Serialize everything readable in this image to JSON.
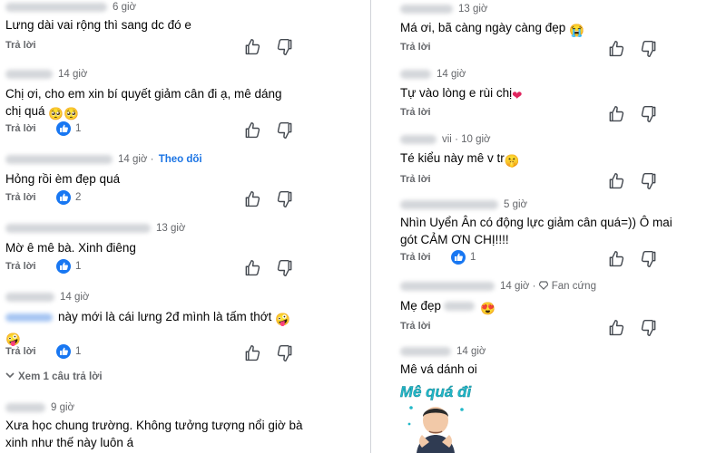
{
  "left": [
    {
      "time": "6 giờ",
      "text": [
        "Lưng dài vai rộng thì sang dc đó e"
      ],
      "reply": "Trả lời",
      "likes": ""
    },
    {
      "time": "14 giờ",
      "text": [
        "Chị ơi, cho em xin bí quyết giảm cân đi ạ, mê dáng",
        "chị quá"
      ],
      "reply": "Trả lời",
      "likes": "1"
    },
    {
      "time": "14 giờ",
      "follow": "Theo dõi",
      "text": [
        "Hỏng rồi èm đẹp quá"
      ],
      "reply": "Trả lời",
      "likes": "2"
    },
    {
      "time": "13 giờ",
      "text": [
        "Mờ ê mê bà. Xinh điêng"
      ],
      "reply": "Trả lời",
      "likes": "1"
    },
    {
      "time": "14 giờ",
      "text": [
        "này mới là cái lưng 2đ mình là tấm thớt",
        ""
      ],
      "reply": "Trả lời",
      "likes": "1"
    },
    {
      "time": "9 giờ",
      "text": [
        "Xưa học chung trường. Không tưởng tượng nổi giờ bà",
        "xinh như thế này luôn á"
      ]
    }
  ],
  "more_replies": "Xem 1 câu trả lời",
  "right": [
    {
      "time": "13 giờ",
      "text": [
        "Má ơi, bã càng ngày càng đẹp"
      ],
      "reply": "Trả lời",
      "likes": ""
    },
    {
      "time": "14 giờ",
      "text": [
        "Tự vào lòng e rùi chị"
      ],
      "reply": "Trả lời",
      "likes": ""
    },
    {
      "time": "10 giờ",
      "name_fragment": "vii",
      "text": [
        "Té kiểu này mê v tr"
      ],
      "reply": "Trả lời",
      "likes": ""
    },
    {
      "time": "5 giờ",
      "text": [
        "Nhìn Uyển Ân có động lực giảm cân quá=)) Ô mai",
        "gót CẢM ƠN CHỊ!!!!"
      ],
      "reply": "Trả lời",
      "likes": "1"
    },
    {
      "time": "14 giờ",
      "fan": "Fan cứng",
      "text": [
        "Mẹ đẹp"
      ],
      "reply": "Trả lời",
      "likes": ""
    },
    {
      "time": "14 giờ",
      "text": [
        "Mê vá dánh oi"
      ]
    }
  ],
  "sticker_text": "Mê quá đi",
  "icons": {
    "like": "thumbs-up-icon",
    "dislike": "thumbs-down-icon",
    "reaction": "like-reaction-icon",
    "fan": "diamond-icon",
    "expand": "chevron-down-icon"
  },
  "colors": {
    "accent": "#1877f2",
    "follow": "#1b74e4",
    "sticker": "#22b8c8"
  }
}
